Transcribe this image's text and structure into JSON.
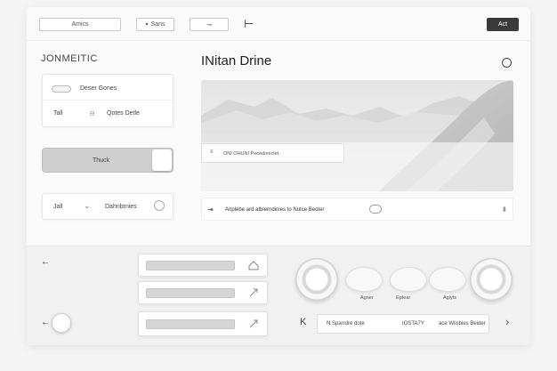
{
  "topbar": {
    "field1": "Amics",
    "field2": "Sans",
    "field3": "",
    "divider_glyph": "⊢",
    "action_button": "Act"
  },
  "sidebar": {
    "brand": "JONMEITIC",
    "card1": {
      "row1_label": "Deser Gones",
      "row2_left": "Tall",
      "row2_right": "Qotes Detle"
    },
    "toggle_label": "Thuck",
    "card2": {
      "left": "Jall",
      "right": "Dahnbrnies"
    }
  },
  "main": {
    "title": "INitan Drine",
    "hero_caption": "ONI OHUNI Pecedonictet",
    "info_text": "Anplebe ard atblerndinies to Nutce Beoter"
  },
  "bottom": {
    "bubble_labels": [
      "Agner",
      "Eptear",
      "Agiyts"
    ],
    "foot_bar": {
      "left": "N Sparrdre dote",
      "middle": "IOSTA7Y",
      "right": "ace Wiisbies Beider"
    },
    "arrow_left": "K",
    "arrow_right": "›"
  },
  "icons": {
    "info": "info-circle-icon",
    "chevron": "chevron-down-icon",
    "bell": "bell-icon",
    "toggle": "toggle-icon",
    "arrow": "arrow-icon",
    "cloud": "cloud-icon",
    "flag": "flag-icon"
  },
  "colors": {
    "dark_button": "#3a3a3a",
    "background": "#f4f4f4",
    "panel": "#fafafa"
  }
}
